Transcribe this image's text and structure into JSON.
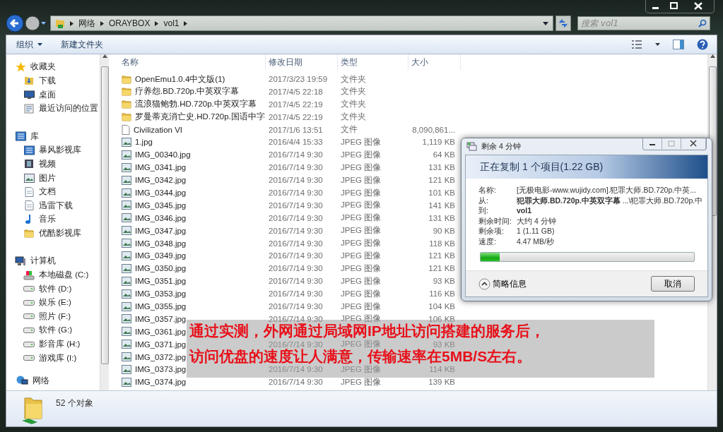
{
  "address_bar": {
    "path": [
      "网络",
      "ORAYBOX",
      "vol1"
    ]
  },
  "search": {
    "placeholder": "搜索 vol1"
  },
  "toolbar": {
    "buttons": [
      {
        "label": "组织",
        "kind": "menu"
      },
      {
        "label": "新建文件夹",
        "kind": "plain"
      }
    ]
  },
  "sidebar": {
    "groups": [
      {
        "label": "收藏夹",
        "kind": "favorites",
        "children": [
          {
            "label": "下载",
            "kind": "download"
          },
          {
            "label": "桌面",
            "kind": "desktop"
          },
          {
            "label": "最近访问的位置",
            "kind": "recent"
          }
        ]
      },
      {
        "label": "库",
        "kind": "library",
        "children": [
          {
            "label": "暴风影视库",
            "kind": "library"
          },
          {
            "label": "视频",
            "kind": "video"
          },
          {
            "label": "图片",
            "kind": "picture"
          },
          {
            "label": "文档",
            "kind": "document"
          },
          {
            "label": "迅雷下载",
            "kind": "document"
          },
          {
            "label": "音乐",
            "kind": "music"
          },
          {
            "label": "优酷影视库",
            "kind": "folder"
          }
        ]
      },
      {
        "label": "计算机",
        "kind": "computer",
        "children": [
          {
            "label": "本地磁盘 (C:)",
            "kind": "system"
          },
          {
            "label": "软件 (D:)",
            "kind": "drive"
          },
          {
            "label": "娱乐 (E:)",
            "kind": "drive"
          },
          {
            "label": "照片 (F:)",
            "kind": "drive"
          },
          {
            "label": "软件 (G:)",
            "kind": "drive"
          },
          {
            "label": "影音库 (H:)",
            "kind": "drive"
          },
          {
            "label": "游戏库 (I:)",
            "kind": "drive"
          }
        ]
      },
      {
        "label": "网络",
        "kind": "network"
      }
    ]
  },
  "file_list": {
    "columns": [
      "名称",
      "修改日期",
      "类型",
      "大小"
    ],
    "rows": [
      {
        "name": "OpenEmu1.0.4中文版(1)",
        "modified": "2017/3/23 19:59",
        "type": "文件夹",
        "kind": "folder"
      },
      {
        "name": "疗养怨.BD.720p.中英双字幕",
        "modified": "2017/4/5 22:18",
        "type": "文件夹",
        "kind": "folder"
      },
      {
        "name": "流浪猫鲍勃.HD.720p.中英双字幕",
        "modified": "2017/4/5 22:19",
        "type": "文件夹",
        "kind": "folder"
      },
      {
        "name": "罗曼蒂克消亡史.HD.720p.国语中字",
        "modified": "2017/4/5 22:19",
        "type": "文件夹",
        "kind": "folder"
      },
      {
        "name": "Civilization VI",
        "modified": "2017/1/6 13:51",
        "type": "文件",
        "size": "8,090,861...",
        "kind": "file"
      },
      {
        "name": "1.jpg",
        "modified": "2016/4/4 15:33",
        "type": "JPEG 图像",
        "size": "1,119 KB",
        "kind": "image"
      },
      {
        "name": "IMG_00340.jpg",
        "modified": "2016/7/14 9:30",
        "type": "JPEG 图像",
        "size": "64 KB",
        "kind": "image"
      },
      {
        "name": "IMG_0341.jpg",
        "modified": "2016/7/14 9:30",
        "type": "JPEG 图像",
        "size": "131 KB",
        "kind": "image"
      },
      {
        "name": "IMG_0342.jpg",
        "modified": "2016/7/14 9:30",
        "type": "JPEG 图像",
        "size": "121 KB",
        "kind": "image"
      },
      {
        "name": "IMG_0344.jpg",
        "modified": "2016/7/14 9:30",
        "type": "JPEG 图像",
        "size": "101 KB",
        "kind": "image"
      },
      {
        "name": "IMG_0345.jpg",
        "modified": "2016/7/14 9:30",
        "type": "JPEG 图像",
        "size": "141 KB",
        "kind": "image"
      },
      {
        "name": "IMG_0346.jpg",
        "modified": "2016/7/14 9:30",
        "type": "JPEG 图像",
        "size": "131 KB",
        "kind": "image"
      },
      {
        "name": "IMG_0347.jpg",
        "modified": "2016/7/14 9:30",
        "type": "JPEG 图像",
        "size": "90 KB",
        "kind": "image"
      },
      {
        "name": "IMG_0348.jpg",
        "modified": "2016/7/14 9:30",
        "type": "JPEG 图像",
        "size": "118 KB",
        "kind": "image"
      },
      {
        "name": "IMG_0349.jpg",
        "modified": "2016/7/14 9:30",
        "type": "JPEG 图像",
        "size": "121 KB",
        "kind": "image"
      },
      {
        "name": "IMG_0350.jpg",
        "modified": "2016/7/14 9:30",
        "type": "JPEG 图像",
        "size": "121 KB",
        "kind": "image"
      },
      {
        "name": "IMG_0351.jpg",
        "modified": "2016/7/14 9:30",
        "type": "JPEG 图像",
        "size": "93 KB",
        "kind": "image"
      },
      {
        "name": "IMG_0353.jpg",
        "modified": "2016/7/14 9:30",
        "type": "JPEG 图像",
        "size": "116 KB",
        "kind": "image"
      },
      {
        "name": "IMG_0355.jpg",
        "modified": "2016/7/14 9:30",
        "type": "JPEG 图像",
        "size": "104 KB",
        "kind": "image"
      },
      {
        "name": "IMG_0357.jpg",
        "modified": "2016/7/14 9:30",
        "type": "JPEG 图像",
        "size": "106 KB",
        "kind": "image"
      },
      {
        "name": "IMG_0361.jpg",
        "kind": "image"
      },
      {
        "name": "IMG_0371.jpg",
        "modified": "2016/7/14 9:30",
        "type": "JPEG 图像",
        "size": "93 KB",
        "kind": "image"
      },
      {
        "name": "IMG_0372.jpg",
        "kind": "image"
      },
      {
        "name": "IMG_0373.jpg",
        "modified": "2016/7/14 9:30",
        "type": "JPEG 图像",
        "size": "114 KB",
        "kind": "image"
      },
      {
        "name": "IMG_0374.jpg",
        "modified": "2016/7/14 9:30",
        "type": "JPEG 图像",
        "size": "139 KB",
        "kind": "image"
      }
    ]
  },
  "details_pane": {
    "count": "52 个对象"
  },
  "copy_dialog": {
    "title": "剩余 4 分钟",
    "heading": "正在复制 1 个项目(1.22 GB)",
    "details": [
      {
        "label": "名称:",
        "value": "[无极电影-www.wujidy.com].犯罪大师.BD.720p.中英...",
        "bold": false
      },
      {
        "label": "从:",
        "value": "**犯罪大师.BD.720p.中英双字幕** ...\\犯罪大师.BD.720p.中",
        "bold": false
      },
      {
        "label": "到:",
        "value": "vol1",
        "bold": true
      },
      {
        "label": "剩余时间:",
        "value": "大约 4 分钟",
        "bold": false
      },
      {
        "label": "剩余项:",
        "value": "1 (1.11 GB)",
        "bold": false
      },
      {
        "label": "速度:",
        "value": "4.47 MB/秒",
        "bold": false
      }
    ],
    "progress": {
      "level": 0.09
    },
    "toggle": "简略信息",
    "cancel": "取消"
  },
  "caption": {
    "lines": [
      "通过实测，外网通过局域网IP地址访问搭建的服务后，",
      "访问优盘的速度让人满意，传输速率在5MB/S左右。"
    ]
  }
}
